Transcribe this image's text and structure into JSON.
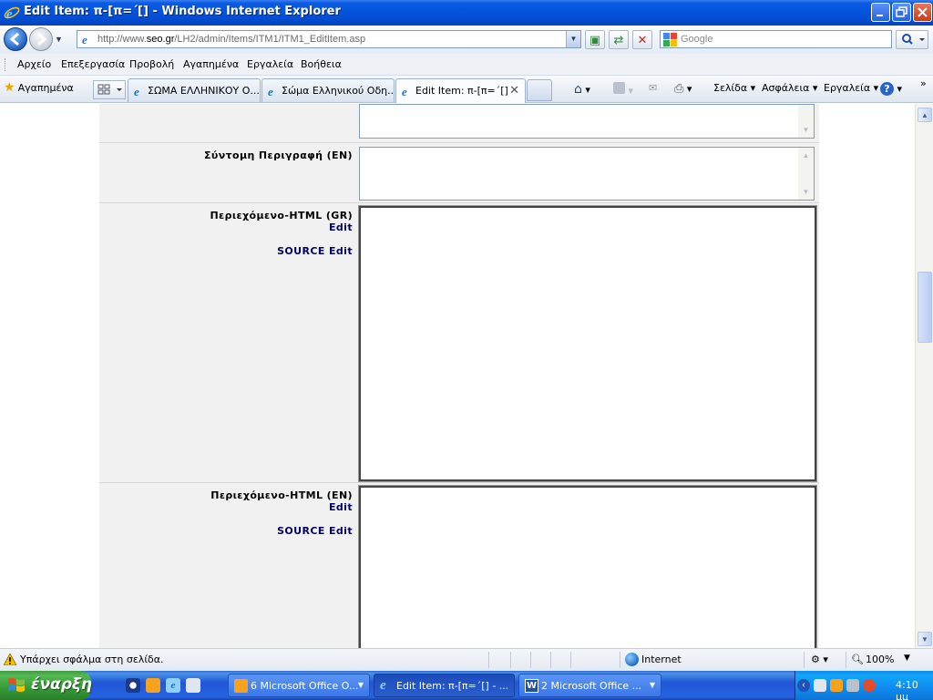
{
  "window": {
    "title": "Edit Item: π-[π=΄[] - Windows Internet Explorer"
  },
  "address": {
    "url_prefix": "http://www.",
    "url_host": "seo.gr",
    "url_path": "/LH2/admin/Items/ITM1/ITM1_EditItem.asp",
    "search_placeholder": "Google"
  },
  "menu": [
    "Αρχείο",
    "Επεξεργασία",
    "Προβολή",
    "Αγαπημένα",
    "Εργαλεία",
    "Βοήθεια"
  ],
  "favorites_label": "Αγαπημένα",
  "tabs": [
    {
      "label": "ΣΩΜΑ ΕΛΛΗΝΙΚΟΥ Ο...",
      "active": false
    },
    {
      "label": "Σώμα Ελληνικού Οδη...",
      "active": false
    },
    {
      "label": "Edit Item: π-[π=΄[]",
      "active": true
    }
  ],
  "commands": {
    "page": "Σελίδα",
    "safety": "Ασφάλεια",
    "tools": "Εργαλεία"
  },
  "form": {
    "short_desc_en_label": "Σύντομη Περιγραφή (EN)",
    "content_gr_label": "Περιεχόμενο-HTML (GR)",
    "content_en_label": "Περιεχόμενο-HTML (EN)",
    "edit_link": "Edit",
    "source_edit_link": "SOURCE Edit"
  },
  "status": {
    "message": "Υπάρχει σφάλμα στη σελίδα.",
    "zone": "Internet",
    "zoom": "100%"
  },
  "taskbar": {
    "start_label": "έναρξη",
    "tasks": [
      {
        "label": "6 Microsoft Office O...",
        "active": false
      },
      {
        "label": "Edit Item: π-[π=΄[] - ...",
        "active": true
      },
      {
        "label": "2 Microsoft Office ...",
        "active": false
      }
    ],
    "clock": "4:10 μμ"
  },
  "colors": {
    "title_bar": "#0453dc",
    "link": "#000066",
    "form_bg": "#f1f1f1",
    "taskbar": "#2157d7",
    "start_button": "#379a37"
  }
}
